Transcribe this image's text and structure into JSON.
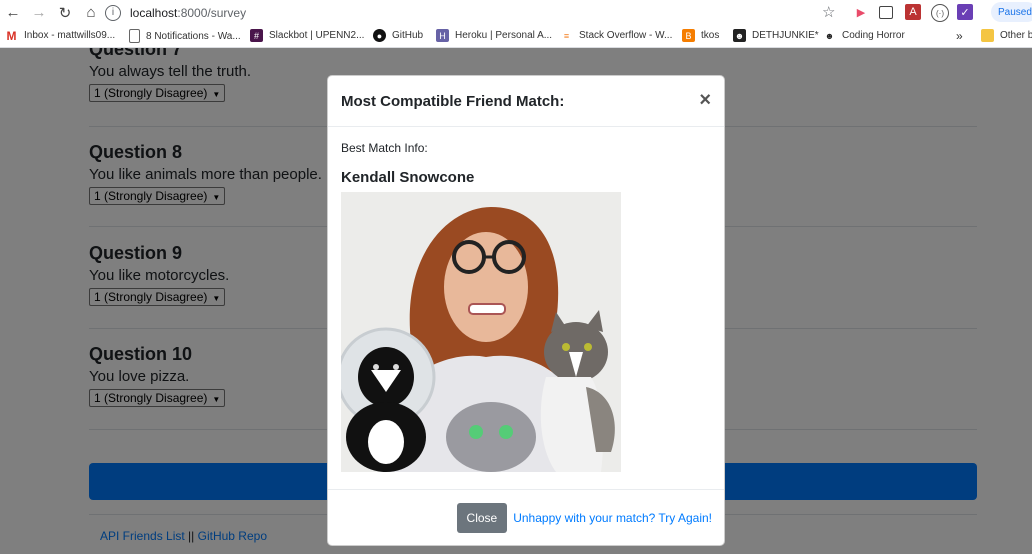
{
  "browser": {
    "url_host": "localhost",
    "url_path": ":8000/survey",
    "paused_label": "Paused",
    "bookmarks": [
      {
        "label": "Inbox - mattwills09...",
        "icon": "gmail-icon"
      },
      {
        "label": "8 Notifications - Wa...",
        "icon": "page-icon"
      },
      {
        "label": "Slackbot | UPENN2...",
        "icon": "slack-icon"
      },
      {
        "label": "GitHub",
        "icon": "github-icon"
      },
      {
        "label": "Heroku | Personal A...",
        "icon": "heroku-icon"
      },
      {
        "label": "Stack Overflow - W...",
        "icon": "stackoverflow-icon"
      },
      {
        "label": "tkos",
        "icon": "blogger-icon"
      },
      {
        "label": "DETHJUNKIE*",
        "icon": "site-icon"
      },
      {
        "label": "Coding Horror",
        "icon": "site-icon"
      }
    ],
    "overflow_label": "»",
    "other_bookmarks_label": "Other b"
  },
  "questions": [
    {
      "title": "Question 7",
      "text": "You always tell the truth.",
      "selected": "1 (Strongly Disagree)"
    },
    {
      "title": "Question 8",
      "text": "You like animals more than people.",
      "selected": "1 (Strongly Disagree)"
    },
    {
      "title": "Question 9",
      "text": "You like motorcycles.",
      "selected": "1 (Strongly Disagree)"
    },
    {
      "title": "Question 10",
      "text": "You love pizza.",
      "selected": "1 (Strongly Disagree)"
    }
  ],
  "footer": {
    "api_link": "API Friends List",
    "separator": "||",
    "github_link": "GitHub Repo"
  },
  "modal": {
    "title": "Most Compatible Friend Match:",
    "close_x": "×",
    "info_label": "Best Match Info:",
    "match_name": "Kendall Snowcone",
    "close_button": "Close",
    "try_again_link": "Unhappy with your match? Try Again!"
  }
}
